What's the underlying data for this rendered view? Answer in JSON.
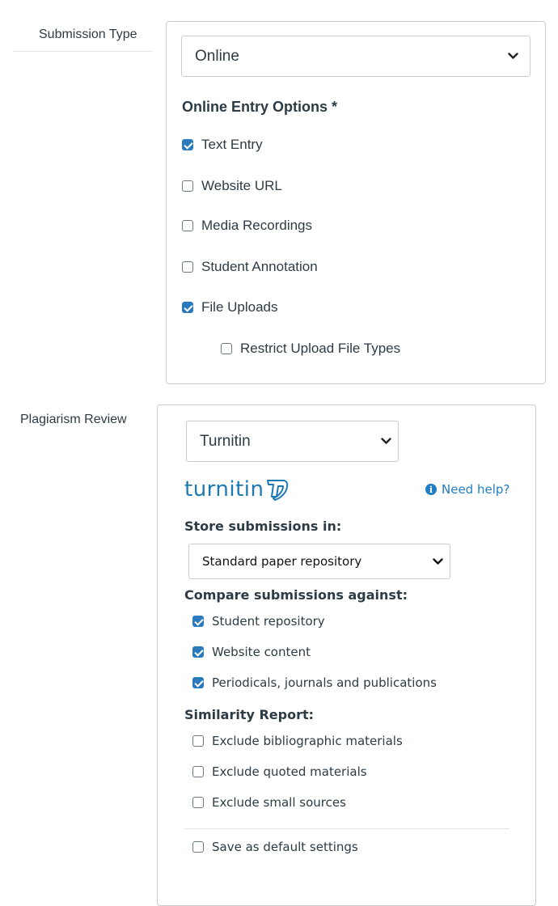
{
  "submission_type": {
    "label": "Submission Type",
    "select_value": "Online",
    "options_heading": "Online Entry Options *",
    "options": [
      {
        "label": "Text Entry",
        "checked": true
      },
      {
        "label": "Website URL",
        "checked": false
      },
      {
        "label": "Media Recordings",
        "checked": false
      },
      {
        "label": "Student Annotation",
        "checked": false
      },
      {
        "label": "File Uploads",
        "checked": true
      }
    ],
    "restrict_upload": {
      "label": "Restrict Upload File Types",
      "checked": false
    }
  },
  "plagiarism": {
    "label": "Plagiarism Review",
    "select_value": "Turnitin",
    "logo_text": "turnitin",
    "help_text": "Need help?",
    "store_heading": "Store submissions in:",
    "store_value": "Standard paper repository",
    "compare_heading": "Compare submissions against:",
    "compare_options": [
      {
        "label": "Student repository",
        "checked": true
      },
      {
        "label": "Website content",
        "checked": true
      },
      {
        "label": "Periodicals, journals and publications",
        "checked": true
      }
    ],
    "similarity_heading": "Similarity Report:",
    "similarity_options": [
      {
        "label": "Exclude bibliographic materials",
        "checked": false
      },
      {
        "label": "Exclude quoted materials",
        "checked": false
      },
      {
        "label": "Exclude small sources",
        "checked": false
      }
    ],
    "save_default": {
      "label": "Save as default settings",
      "checked": false
    }
  },
  "colors": {
    "accent": "#2b7abc",
    "turnitin_blue": "#1e78b4",
    "border": "#c7cdd1",
    "text": "#2d3b45"
  }
}
